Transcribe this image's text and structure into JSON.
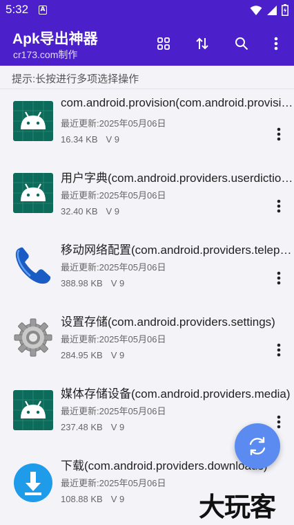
{
  "status_bar": {
    "time": "5:32",
    "notif_letter": "A"
  },
  "app_bar": {
    "title": "Apk导出神器",
    "subtitle": "cr173.com制作",
    "actions": [
      "grid-view-icon",
      "sort-icon",
      "search-icon",
      "more-vert-icon"
    ]
  },
  "hint": "提示:长按进行多项选择操作",
  "apps": [
    {
      "name": "com.android.provision(com.android.provision)",
      "updated": "最近更新:2025年05月06日",
      "size": "16.34 KB",
      "version": "V 9",
      "icon": "android-default-icon"
    },
    {
      "name": "用户字典(com.android.providers.userdictionary)",
      "updated": "最近更新:2025年05月06日",
      "size": "32.40 KB",
      "version": "V 9",
      "icon": "android-default-icon"
    },
    {
      "name": "移动网络配置(com.android.providers.telephony)",
      "updated": "最近更新:2025年05月06日",
      "size": "388.98 KB",
      "version": "V 9",
      "icon": "phone-icon"
    },
    {
      "name": "设置存储(com.android.providers.settings)",
      "updated": "最近更新:2025年05月06日",
      "size": "284.95 KB",
      "version": "V 9",
      "icon": "gear-icon"
    },
    {
      "name": "媒体存储设备(com.android.providers.media)",
      "updated": "最近更新:2025年05月06日",
      "size": "237.48 KB",
      "version": "V 9",
      "icon": "android-default-icon"
    },
    {
      "name": "下载(com.android.providers.downloads)",
      "updated": "最近更新:2025年05月06日",
      "size": "108.88 KB",
      "version": "V 9",
      "icon": "download-icon"
    }
  ],
  "fab": {
    "icon": "refresh-icon"
  },
  "watermark": "大玩客",
  "colors": {
    "primary": "#4b1fc9",
    "fab": "#5b8bf0",
    "android_tile": "#0c6b5a",
    "download": "#1e9be9",
    "phone": "#1a5cc4"
  }
}
